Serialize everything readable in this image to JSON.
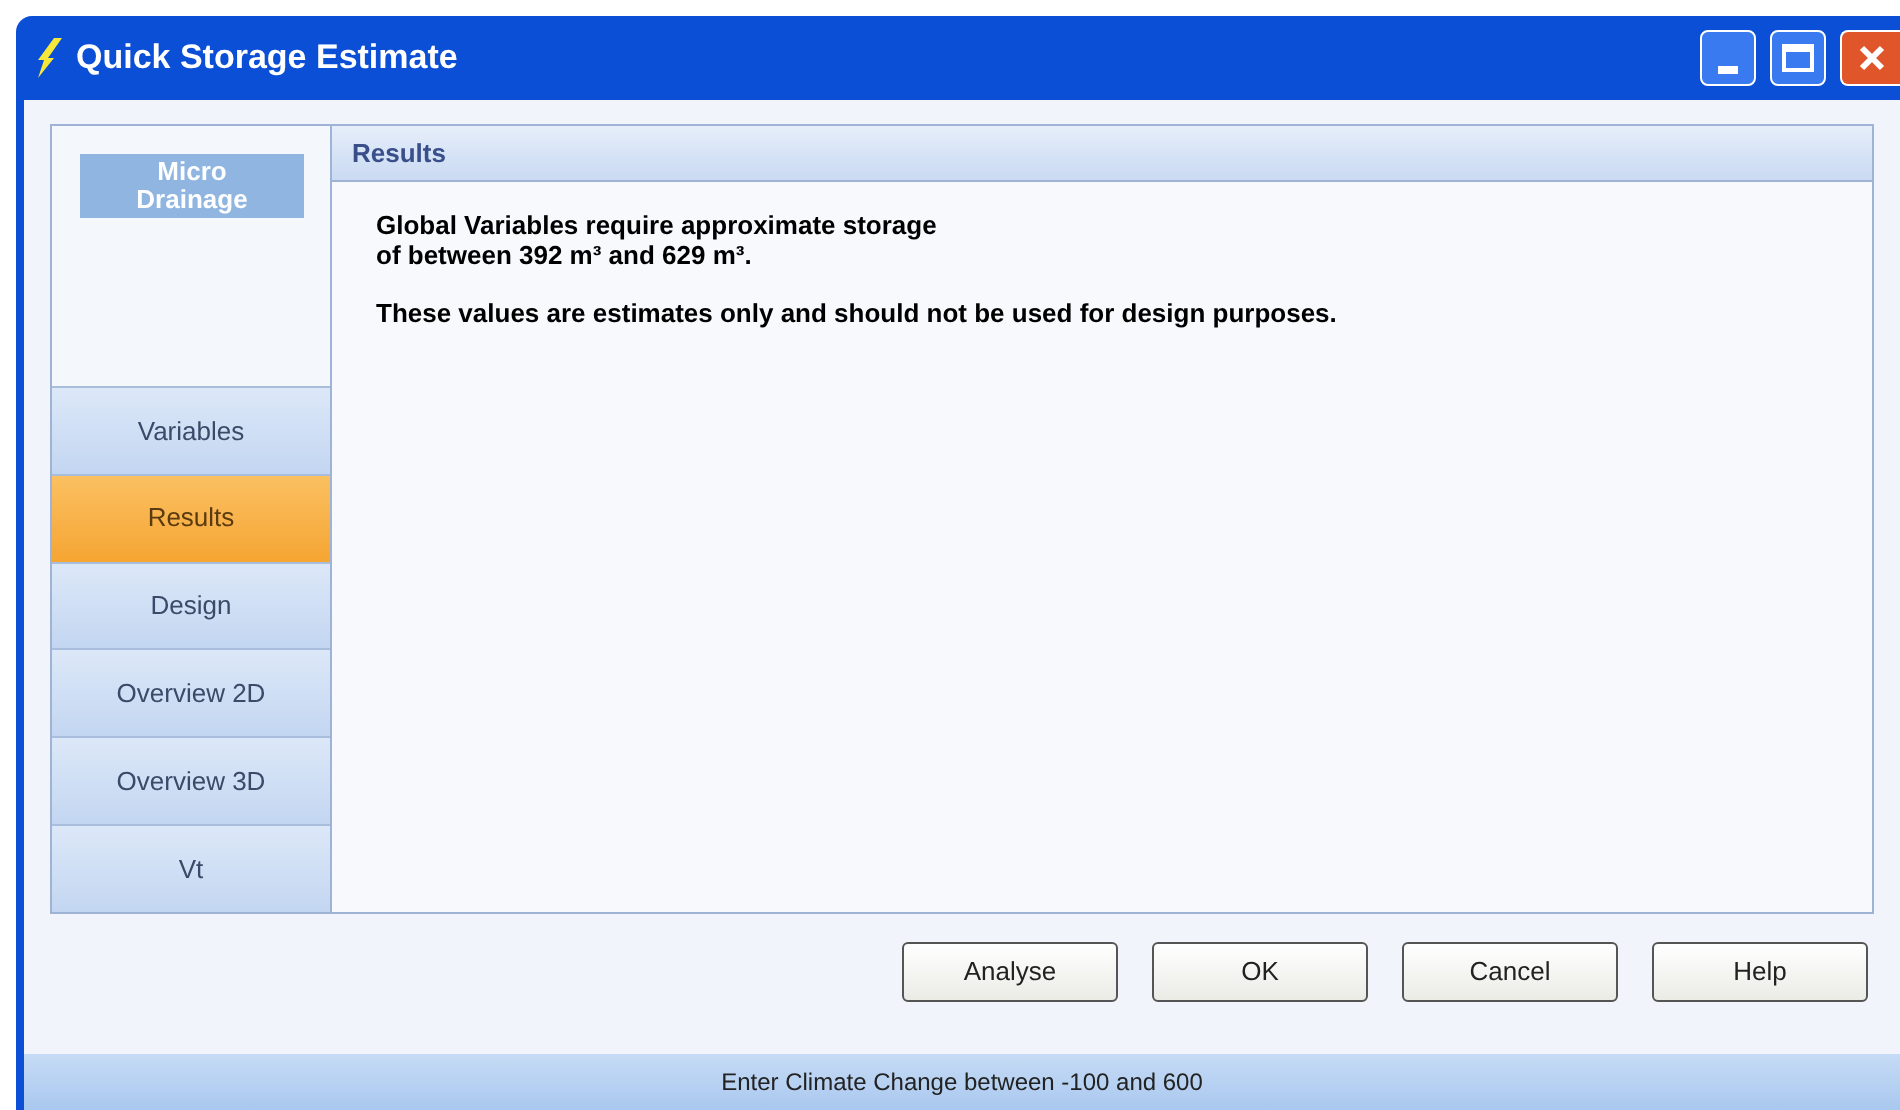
{
  "window": {
    "title": "Quick Storage Estimate"
  },
  "logo": {
    "line_1": "Micro",
    "line_2": "Drainage"
  },
  "nav": [
    {
      "label": "Variables",
      "selected": false
    },
    {
      "label": "Results",
      "selected": true
    },
    {
      "label": "Design",
      "selected": false
    },
    {
      "label": "Overview 2D",
      "selected": false
    },
    {
      "label": "Overview 3D",
      "selected": false
    },
    {
      "label": "Vt",
      "selected": false
    }
  ],
  "panel": {
    "header": "Results",
    "lines": [
      "Global Variables require approximate storage",
      "of between 392 m³ and 629 m³."
    ],
    "note": "These values are estimates only and should not be used for design purposes."
  },
  "buttons": [
    "Analyse",
    "OK",
    "Cancel",
    "Help"
  ],
  "status_bar": "Enter Climate Change between -100 and 600"
}
